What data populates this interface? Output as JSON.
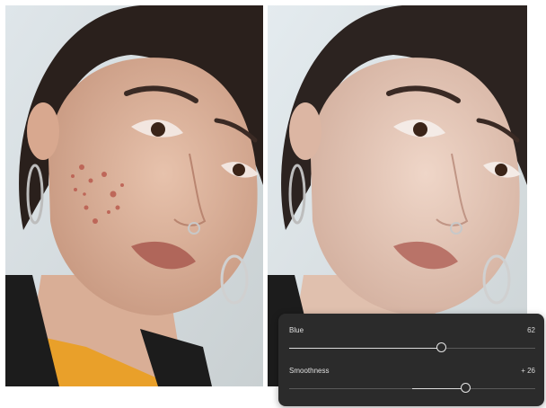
{
  "sliders": [
    {
      "label": "Blue",
      "value_text": "62",
      "level_fraction": 0.62,
      "fill_from_fraction": 0.0
    },
    {
      "label": "Smoothness",
      "value_text": "+ 26",
      "level_fraction": 0.72,
      "fill_from_fraction": 0.5
    }
  ],
  "colors": {
    "panel_bg": "#2b2b2b",
    "slider_fill": "#dcdcdc",
    "slider_track": "#5a5a5a"
  }
}
